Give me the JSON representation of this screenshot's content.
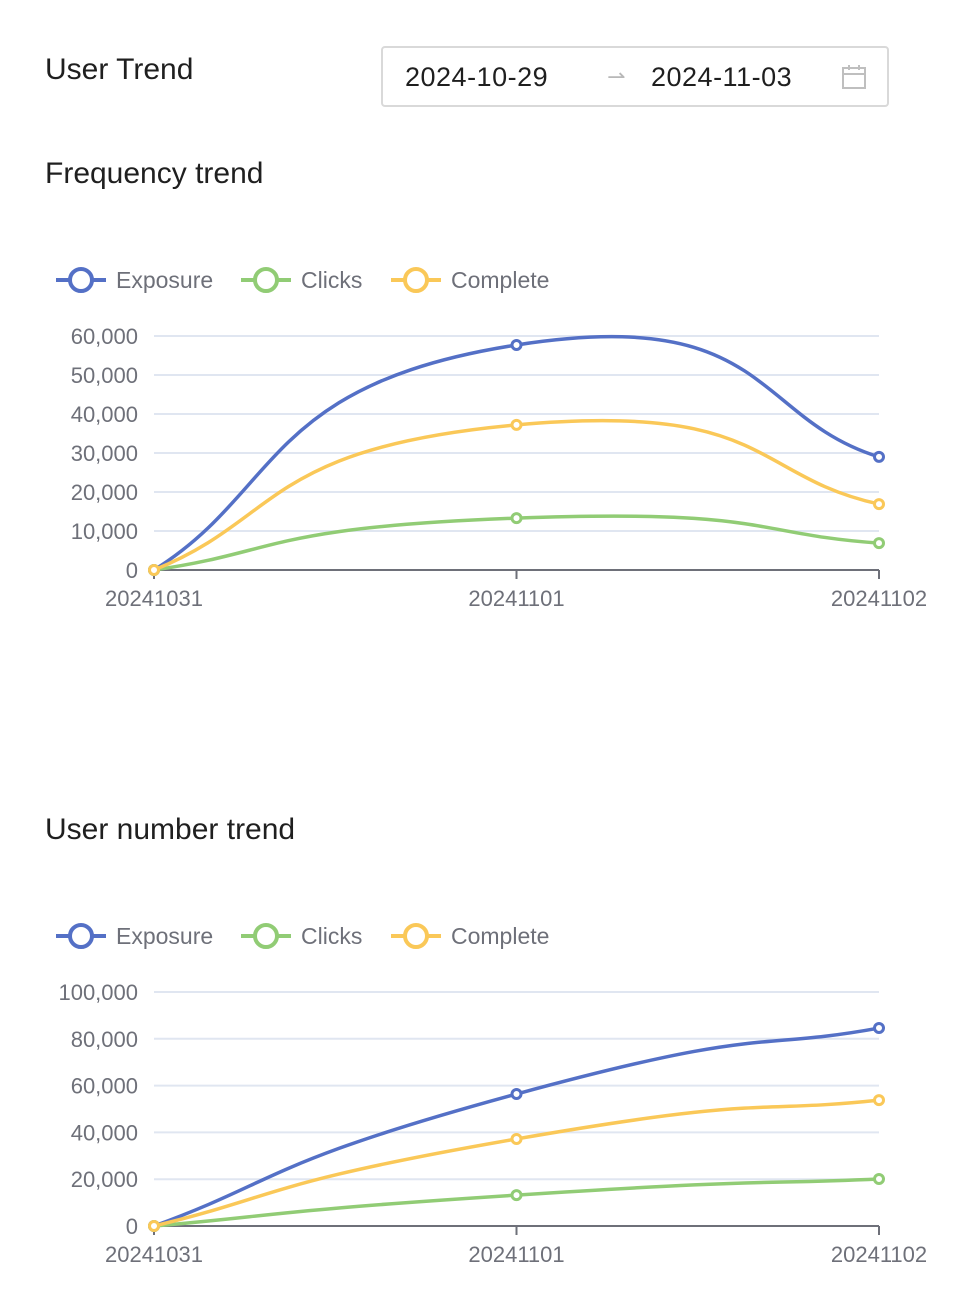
{
  "header": {
    "title": "User Trend",
    "date_range": {
      "start": "2024-10-29",
      "separator": "→",
      "end": "2024-11-03",
      "icon": "calendar-icon"
    }
  },
  "colors": {
    "Exposure": "#5470c6",
    "Clicks": "#91cc75",
    "Complete": "#fac858",
    "grid": "#e0e6f1",
    "axis": "#6e7079",
    "label": "#6e7079"
  },
  "chart_data": [
    {
      "type": "line",
      "title": "Frequency trend",
      "smooth": true,
      "legend": [
        "Exposure",
        "Clicks",
        "Complete"
      ],
      "legend_position": "top-left",
      "categories": [
        "20241031",
        "20241101",
        "20241102"
      ],
      "ylim": [
        0,
        60000
      ],
      "yticks": [
        0,
        10000,
        20000,
        30000,
        40000,
        50000,
        60000
      ],
      "ytick_labels": [
        "0",
        "10,000",
        "20,000",
        "30,000",
        "40,000",
        "50,000",
        "60,000"
      ],
      "grid": true,
      "xlabel": "",
      "ylabel": "",
      "series": [
        {
          "name": "Exposure",
          "values": [
            0,
            57700,
            29000
          ]
        },
        {
          "name": "Clicks",
          "values": [
            0,
            13300,
            6900
          ]
        },
        {
          "name": "Complete",
          "values": [
            0,
            37200,
            16900
          ]
        }
      ]
    },
    {
      "type": "line",
      "title": "User number trend",
      "smooth": true,
      "legend": [
        "Exposure",
        "Clicks",
        "Complete"
      ],
      "legend_position": "top-left",
      "categories": [
        "20241031",
        "20241101",
        "20241102"
      ],
      "ylim": [
        0,
        100000
      ],
      "yticks": [
        0,
        20000,
        40000,
        60000,
        80000,
        100000
      ],
      "ytick_labels": [
        "0",
        "20,000",
        "40,000",
        "60,000",
        "80,000",
        "100,000"
      ],
      "grid": true,
      "xlabel": "",
      "ylabel": "",
      "series": [
        {
          "name": "Exposure",
          "values": [
            0,
            56400,
            84600
          ]
        },
        {
          "name": "Clicks",
          "values": [
            0,
            13200,
            20100
          ]
        },
        {
          "name": "Complete",
          "values": [
            0,
            37200,
            53800
          ]
        }
      ]
    }
  ]
}
